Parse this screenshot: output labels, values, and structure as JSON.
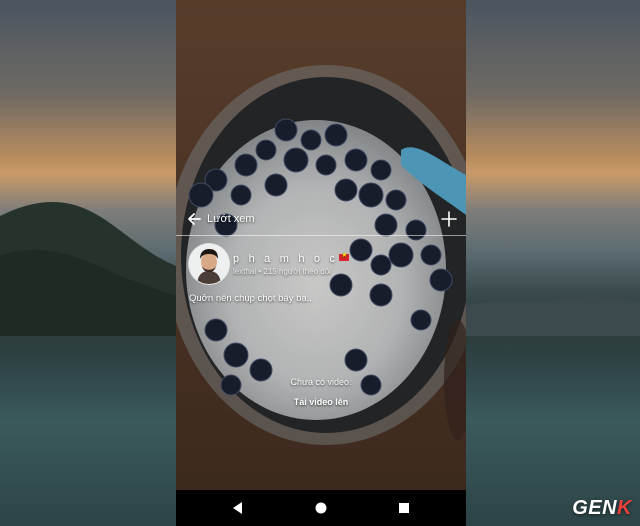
{
  "header": {
    "title": "Lướt xem"
  },
  "profile": {
    "username": "p h a m h o c",
    "handle": "lexthai",
    "followers": "215 người theo dõi",
    "bio": "Quởn nên chụp chọt bậy bạ.."
  },
  "feed": {
    "empty_message": "Chưa có video.",
    "upload_label": "Tải video lên"
  },
  "watermark": {
    "prefix": "GEN",
    "suffix": "K"
  },
  "colors": {
    "brand_accent": "#e8413a",
    "overlay_text": "#ffffff"
  },
  "icons": {
    "back": "arrow-left-icon",
    "add": "plus-icon",
    "nav_back": "triangle-back-icon",
    "nav_home": "circle-home-icon",
    "nav_recent": "square-recent-icon"
  }
}
